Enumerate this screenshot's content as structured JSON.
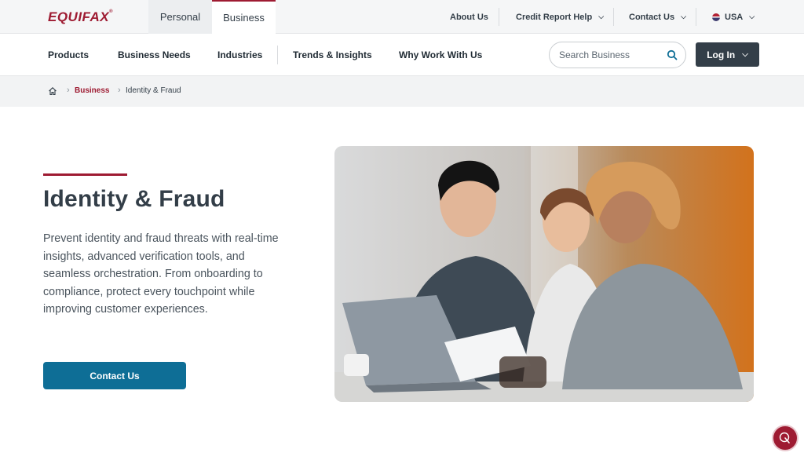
{
  "brand": {
    "logo_text": "EQUIFAX"
  },
  "segments": {
    "personal": "Personal",
    "business": "Business"
  },
  "utility_nav": {
    "about": "About Us",
    "credit_help": "Credit Report Help",
    "contact": "Contact Us",
    "country": "USA"
  },
  "main_nav": {
    "items": [
      "Products",
      "Business Needs",
      "Industries",
      "Trends & Insights",
      "Why Work With Us"
    ]
  },
  "search": {
    "placeholder": "Search Business"
  },
  "login": {
    "label": "Log In"
  },
  "breadcrumb": {
    "parent": "Business",
    "current": "Identity & Fraud"
  },
  "hero": {
    "title": "Identity & Fraud",
    "description": "Prevent identity and fraud threats with real-time insights, advanced verification tools, and seamless orchestration. From onboarding to compliance, protect every touchpoint while improving customer experiences.",
    "cta_label": "Contact Us"
  },
  "colors": {
    "brand_red": "#9e1b32",
    "cta_blue": "#0e6e96",
    "dark_slate": "#333e48"
  },
  "icons": [
    "search-icon",
    "home-icon",
    "chevron-down-icon",
    "us-flag-icon",
    "chat-icon"
  ]
}
